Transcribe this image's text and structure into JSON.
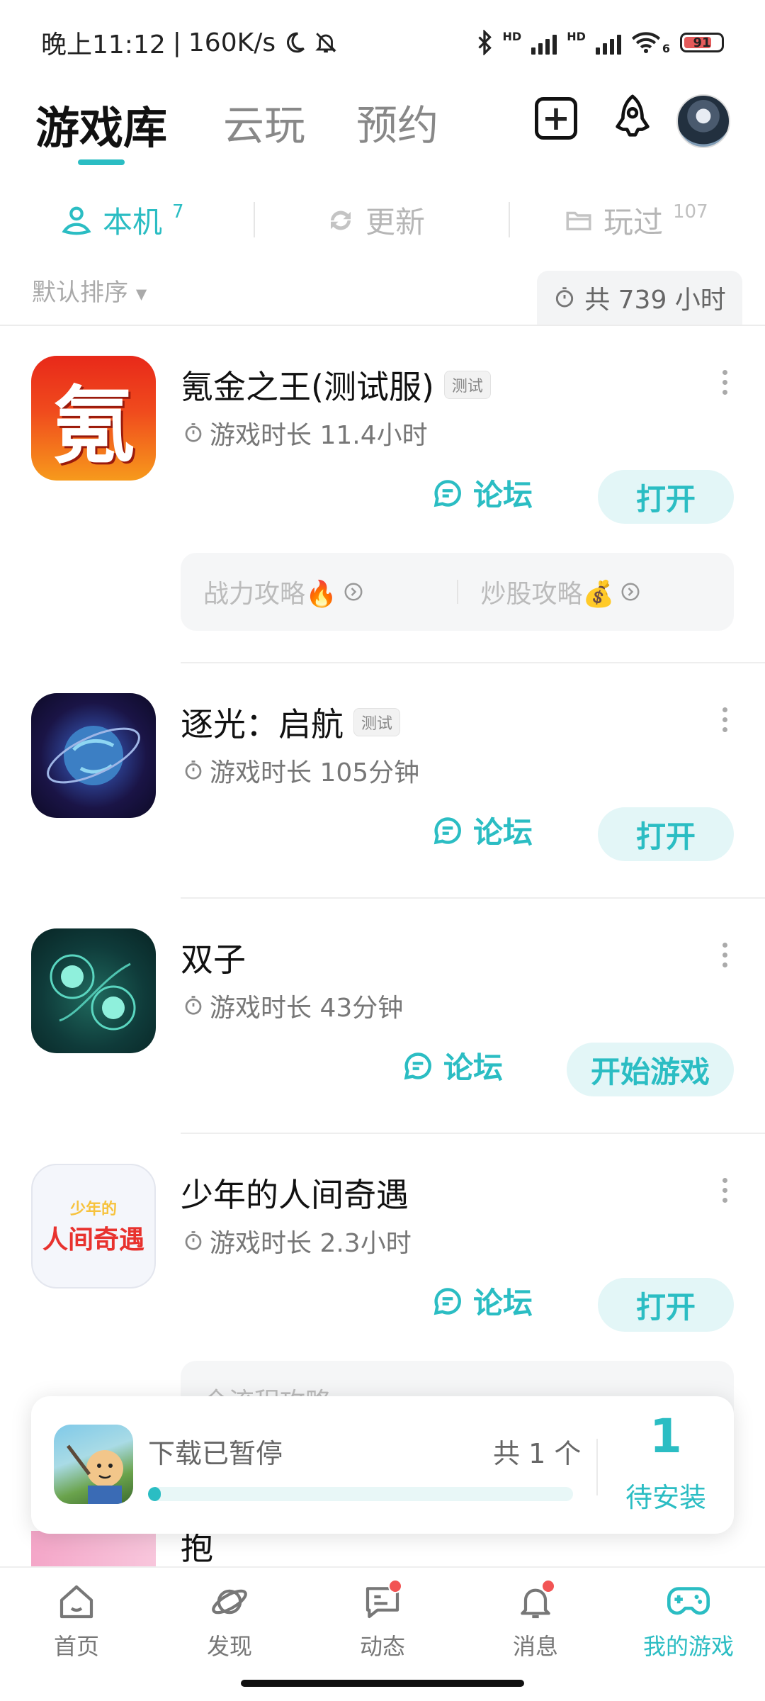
{
  "status_bar": {
    "time": "晚上11:12",
    "net_speed": "160K/s",
    "signal_label_1": "HD",
    "signal_label_2": "HD",
    "wifi_label": "6",
    "battery": "91"
  },
  "header": {
    "tabs": [
      {
        "label": "游戏库",
        "active": true
      },
      {
        "label": "云玩",
        "active": false
      },
      {
        "label": "预约",
        "active": false
      }
    ]
  },
  "subtabs": [
    {
      "label": "本机",
      "count": "7",
      "active": true,
      "icon": "device-person-icon"
    },
    {
      "label": "更新",
      "count": "",
      "active": false,
      "icon": "refresh-icon"
    },
    {
      "label": "玩过",
      "count": "107",
      "active": false,
      "icon": "folder-icon"
    }
  ],
  "sort": {
    "label": "默认排序"
  },
  "total_time": "共 739 小时",
  "games": [
    {
      "title": "氪金之王(测试服)",
      "badge": "测试",
      "play_time": "游戏时长 11.4小时",
      "forum": "论坛",
      "action": "打开",
      "guides": [
        "战力攻略🔥",
        "炒股攻略💰"
      ]
    },
    {
      "title": "逐光：启航",
      "badge": "测试",
      "play_time": "游戏时长 105分钟",
      "forum": "论坛",
      "action": "打开"
    },
    {
      "title": "双子",
      "badge": "",
      "play_time": "游戏时长 43分钟",
      "forum": "论坛",
      "action": "开始游戏"
    },
    {
      "title": "少年的人间奇遇",
      "badge": "",
      "play_time": "游戏时长 2.3小时",
      "forum": "论坛",
      "action": "打开",
      "guides": [
        "全流程攻略"
      ]
    }
  ],
  "game_icon_text": {
    "krypton": "氪",
    "youth_line1": "少年的",
    "youth_line2": "人间奇遇"
  },
  "peek_title": "抱",
  "download": {
    "status": "下载已暂停",
    "total": "共 1 个",
    "progress_percent": 2,
    "pending_count": "1",
    "pending_label": "待安装"
  },
  "bottom_nav": [
    {
      "label": "首页",
      "active": false,
      "dot": false
    },
    {
      "label": "发现",
      "active": false,
      "dot": false
    },
    {
      "label": "动态",
      "active": false,
      "dot": true
    },
    {
      "label": "消息",
      "active": false,
      "dot": true
    },
    {
      "label": "我的游戏",
      "active": true,
      "dot": false
    }
  ],
  "colors": {
    "accent": "#2bbdc3",
    "dot": "#f25454"
  }
}
